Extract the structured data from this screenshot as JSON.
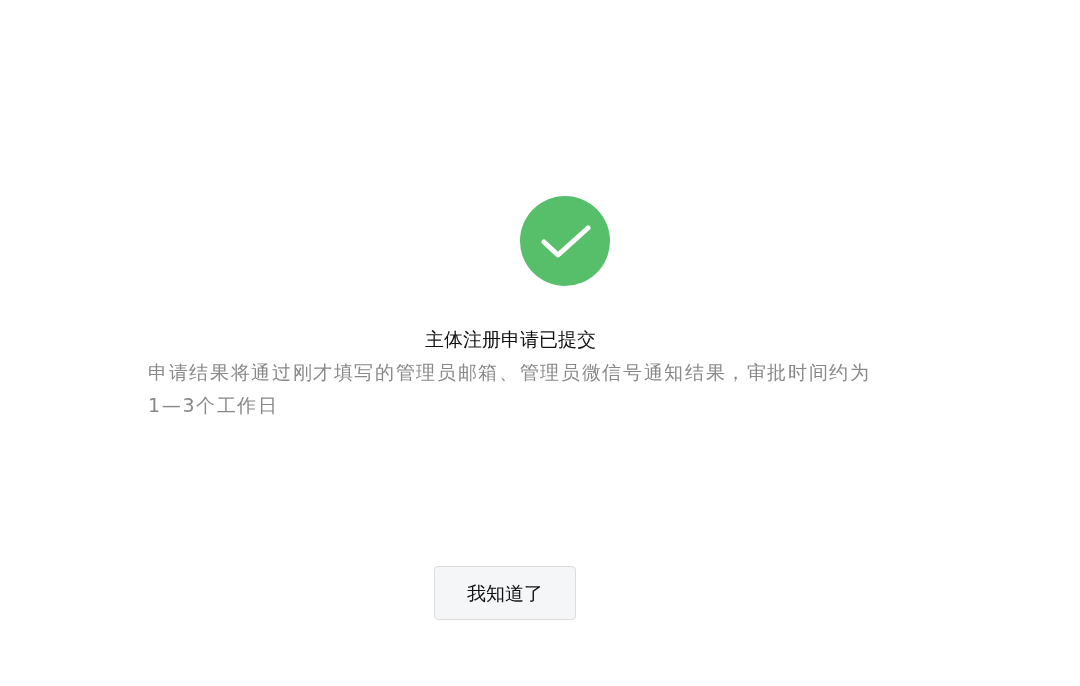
{
  "result": {
    "success": true,
    "title": "主体注册申请已提交",
    "message": "申请结果将通过刚才填写的管理员邮箱、管理员微信号通知结果，审批时间约为1—3个工作日"
  },
  "buttons": [
    {
      "label": "我知道了"
    }
  ]
}
